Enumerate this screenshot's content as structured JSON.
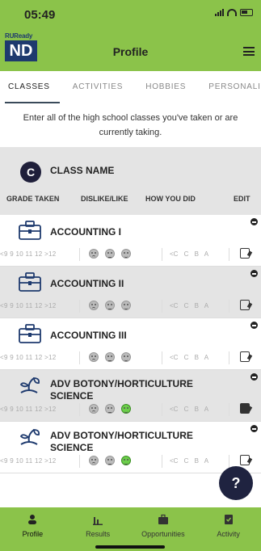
{
  "status_bar": {
    "time": "05:49"
  },
  "header": {
    "logo_top": "RUReady",
    "logo_main": "ND",
    "logo_sub": "gov",
    "title": "Profile",
    "menu_icon": "hamburger-menu-icon"
  },
  "tabs": [
    {
      "label": "CLASSES",
      "active": true
    },
    {
      "label": "ACTIVITIES",
      "active": false
    },
    {
      "label": "HOBBIES",
      "active": false
    },
    {
      "label": "PERSONALIT",
      "active": false
    }
  ],
  "intro_text": "Enter all of the high school classes you've taken or are currently taking.",
  "table": {
    "avatar_letter": "C",
    "class_name_header": "CLASS NAME",
    "columns": [
      "GRADE TAKEN",
      "DISLIKE/LIKE",
      "HOW YOU DID",
      "EDIT"
    ],
    "grade_options": "<9 9 10 11 12 >12",
    "mark_options": "<C C B A"
  },
  "classes": [
    {
      "name": "ACCOUNTING I",
      "icon": "briefcase-icon",
      "like": "none",
      "edited": false
    },
    {
      "name": "ACCOUNTING II",
      "icon": "briefcase-icon",
      "like": "none",
      "edited": false
    },
    {
      "name": "ACCOUNTING III",
      "icon": "briefcase-icon",
      "like": "none",
      "edited": false
    },
    {
      "name": "ADV BOTONY/HORTICULTURE SCIENCE",
      "icon": "plant-icon",
      "like": "like",
      "edited": true
    },
    {
      "name": "ADV BOTONY/HORTICULTURE SCIENCE",
      "icon": "plant-icon",
      "like": "like",
      "edited": false
    }
  ],
  "help_button": "?",
  "bottom_nav": [
    {
      "label": "Profile",
      "icon": "person-icon",
      "active": true
    },
    {
      "label": "Results",
      "icon": "bar-chart-icon",
      "active": false
    },
    {
      "label": "Opportunities",
      "icon": "briefcase-icon",
      "active": false
    },
    {
      "label": "Activity",
      "icon": "checklist-icon",
      "active": false
    }
  ],
  "colors": {
    "header_green": "#8bc34a",
    "navy": "#1e3a6e",
    "row_gray": "#e4e4e4",
    "like_green": "#6ccf4a"
  }
}
